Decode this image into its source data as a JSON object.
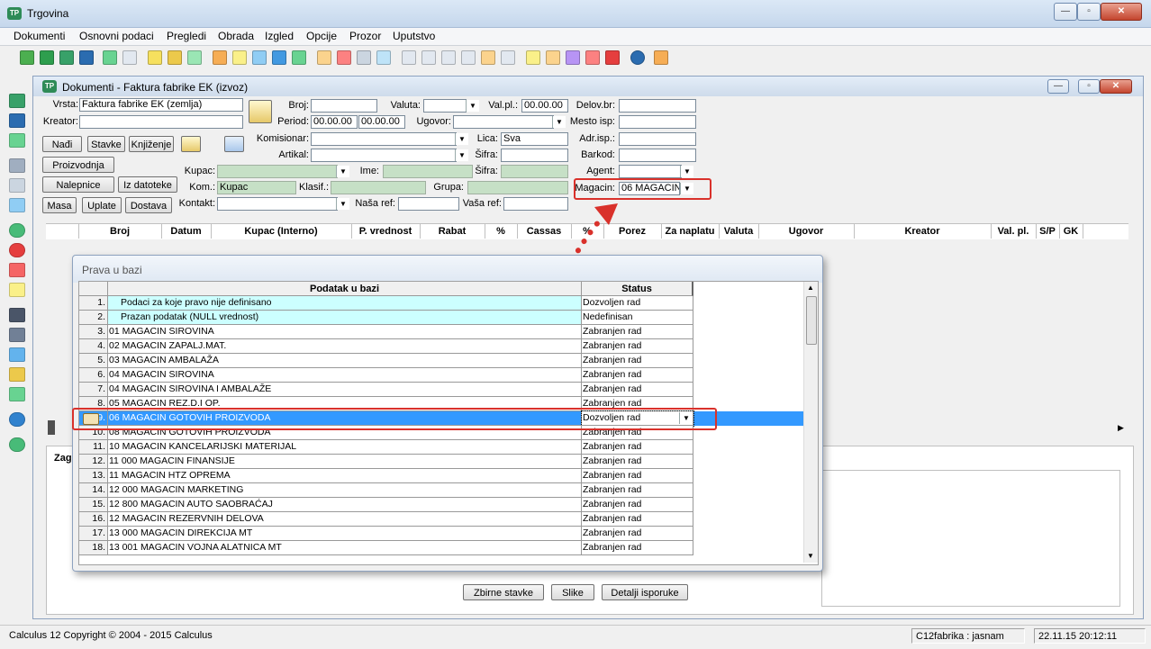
{
  "window": {
    "title": "Trgovina",
    "app_icon": "TP"
  },
  "menu": [
    "Dokumenti",
    "Osnovni podaci",
    "Pregledi",
    "Obrada",
    "Izgled",
    "Opcije",
    "Prozor",
    "Uputstvo"
  ],
  "inner": {
    "title": "Dokumenti - Faktura fabrike EK (izvoz)",
    "labels": {
      "vrsta": "Vrsta:",
      "kreator": "Kreator:",
      "broj": "Broj:",
      "valuta": "Valuta:",
      "valpl": "Val.pl.:",
      "delovbr": "Delov.br:",
      "period": "Period:",
      "ugovor": "Ugovor:",
      "mestoisp": "Mesto isp:",
      "komisionar": "Komisionar:",
      "lica": "Lica:",
      "adrisp": "Adr.isp.:",
      "artikal": "Artikal:",
      "sifra": "Šifra:",
      "barkod": "Barkod:",
      "kupac": "Kupac:",
      "ime": "Ime:",
      "sifra2": "Šifra:",
      "agent": "Agent:",
      "kom": "Kom.:",
      "klasif": "Klasif.:",
      "grupa": "Grupa:",
      "magacin": "Magacin:",
      "kontakt": "Kontakt:",
      "nasaref": "Naša ref:",
      "vasaref": "Vaša ref:"
    },
    "values": {
      "vrsta": "Faktura fabrike EK (zemlja)",
      "valpl": "00.00.00",
      "period_from": "00.00.00",
      "period_to": "00.00.00",
      "lica": "Sva",
      "kom": "Kupac",
      "magacin": "06 MAGACIN"
    },
    "buttons": {
      "nadji": "Nađi",
      "stavke": "Stavke",
      "knjizenje": "Knjiženje",
      "proizvodnja": "Proizvodnja",
      "nalepnice": "Nalepnice",
      "izdatoteke": "Iz datoteke",
      "masa": "Masa",
      "uplate": "Uplate",
      "dostava": "Dostava"
    },
    "columns": [
      "Broj",
      "Datum",
      "Kupac (Interno)",
      "P. vrednost",
      "Rabat",
      "%",
      "Cassas",
      "%",
      "Porez",
      "Za naplatu",
      "Valuta",
      "Ugovor",
      "Kreator",
      "Val. pl.",
      "S/P",
      "GK"
    ],
    "bottom_tab": "Zag",
    "bottom_buttons": [
      "Zbirne stavke",
      "Slike",
      "Detalji isporuke"
    ]
  },
  "dialog": {
    "title": "Prava u bazi",
    "col_data": "Podatak u bazi",
    "col_status": "Status",
    "rows": [
      {
        "n": "1.",
        "data": "Podaci za koje pravo nije definisano",
        "status": "Dozvoljen rad",
        "special": true
      },
      {
        "n": "2.",
        "data": "Prazan podatak (NULL vrednost)",
        "status": "Nedefinisan",
        "special": true
      },
      {
        "n": "3.",
        "data": "01 MAGACIN SIROVINA",
        "status": "Zabranjen rad"
      },
      {
        "n": "4.",
        "data": "02 MAGACIN ZAPALJ.MAT.",
        "status": "Zabranjen rad"
      },
      {
        "n": "5.",
        "data": "03 MAGACIN AMBALAŽA",
        "status": "Zabranjen rad"
      },
      {
        "n": "6.",
        "data": "04 MAGACIN SIROVINA",
        "status": "Zabranjen rad"
      },
      {
        "n": "7.",
        "data": "04 MAGACIN SIROVINA I AMBALAŽE",
        "status": "Zabranjen rad"
      },
      {
        "n": "8.",
        "data": "05 MAGACIN REZ.D.I OP.",
        "status": "Zabranjen rad"
      },
      {
        "n": "9.",
        "data": "06 MAGACIN GOTOVIH PROIZVODA",
        "status": "Dozvoljen rad",
        "selected": true
      },
      {
        "n": "10.",
        "data": "08 MAGACIN GOTOVIH PROIZVODA",
        "status": "Zabranjen rad"
      },
      {
        "n": "11.",
        "data": "10 MAGACIN KANCELARIJSKI MATERIJAL",
        "status": "Zabranjen rad"
      },
      {
        "n": "12.",
        "data": "11 000  MAGACIN FINANSIJE",
        "status": "Zabranjen rad"
      },
      {
        "n": "13.",
        "data": "11 MAGACIN HTZ OPREMA",
        "status": "Zabranjen rad"
      },
      {
        "n": "14.",
        "data": "12 000 MAGACIN MARKETING",
        "status": "Zabranjen rad"
      },
      {
        "n": "15.",
        "data": "12 800 MAGACIN AUTO SAOBRAĆAJ",
        "status": "Zabranjen rad"
      },
      {
        "n": "16.",
        "data": "12 MAGACIN REZERVNIH DELOVA",
        "status": "Zabranjen rad"
      },
      {
        "n": "17.",
        "data": "13 000 MAGACIN DIREKCIJA  MT",
        "status": "Zabranjen rad"
      },
      {
        "n": "18.",
        "data": "13 001 MAGACIN VOJNA ALATNICA MT",
        "status": "Zabranjen rad"
      }
    ]
  },
  "statusbar": {
    "left": "Calculus 12  Copyright © 2004 - 2015  Calculus",
    "user": "C12fabrika : jasnam",
    "datetime": "22.11.15 20:12:11"
  },
  "colors": {
    "selected_row": "#3399ff",
    "special_row": "#ccffff",
    "green_field": "#c6e0c6",
    "highlight": "#d9312b"
  }
}
